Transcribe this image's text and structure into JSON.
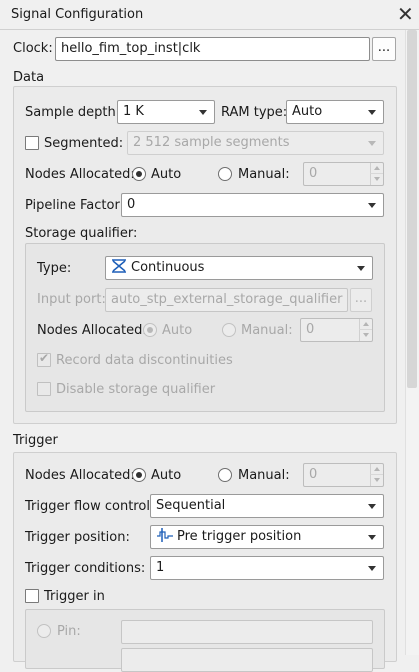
{
  "window": {
    "title": "Signal Configuration"
  },
  "clock": {
    "label": "Clock:",
    "value": "hello_fim_top_inst|clk",
    "browse_label": "..."
  },
  "data": {
    "section_label": "Data",
    "sample_depth_label": "Sample depth:",
    "sample_depth_value": "1 K",
    "ram_type_label": "RAM type:",
    "ram_type_value": "Auto",
    "segmented_label": "Segmented:",
    "segmented_checked": false,
    "segmented_value": "2  512 sample segments",
    "nodes_allocated_label": "Nodes Allocated:",
    "auto_label": "Auto",
    "manual_label": "Manual:",
    "manual_value": "0",
    "pipeline_label": "Pipeline Factor:",
    "pipeline_value": "0",
    "storage_qualifier_label": "Storage qualifier:",
    "storage": {
      "type_label": "Type:",
      "type_value": "Continuous",
      "input_port_label": "Input port:",
      "input_port_value": "auto_stp_external_storage_qualifier",
      "input_port_browse": "...",
      "nodes_allocated_label": "Nodes Allocated:",
      "auto_label": "Auto",
      "manual_label": "Manual:",
      "manual_value": "0",
      "record_label": "Record data discontinuities",
      "record_checked": true,
      "disable_label": "Disable storage qualifier",
      "disable_checked": false
    }
  },
  "trigger": {
    "section_label": "Trigger",
    "nodes_allocated_label": "Nodes Allocated:",
    "auto_label": "Auto",
    "manual_label": "Manual:",
    "manual_value": "0",
    "flow_control_label": "Trigger flow control:",
    "flow_control_value": "Sequential",
    "position_label": "Trigger position:",
    "position_value": "Pre trigger position",
    "conditions_label": "Trigger conditions:",
    "conditions_value": "1",
    "trigger_in_label": "Trigger in",
    "trigger_in_checked": false,
    "pin_label": "Pin:"
  },
  "icons": {
    "close": "close-icon",
    "continuous": "continuous-icon",
    "pre_trigger": "pre-trigger-position-icon"
  },
  "colors": {
    "accent_icon": "#1e5fb8"
  }
}
